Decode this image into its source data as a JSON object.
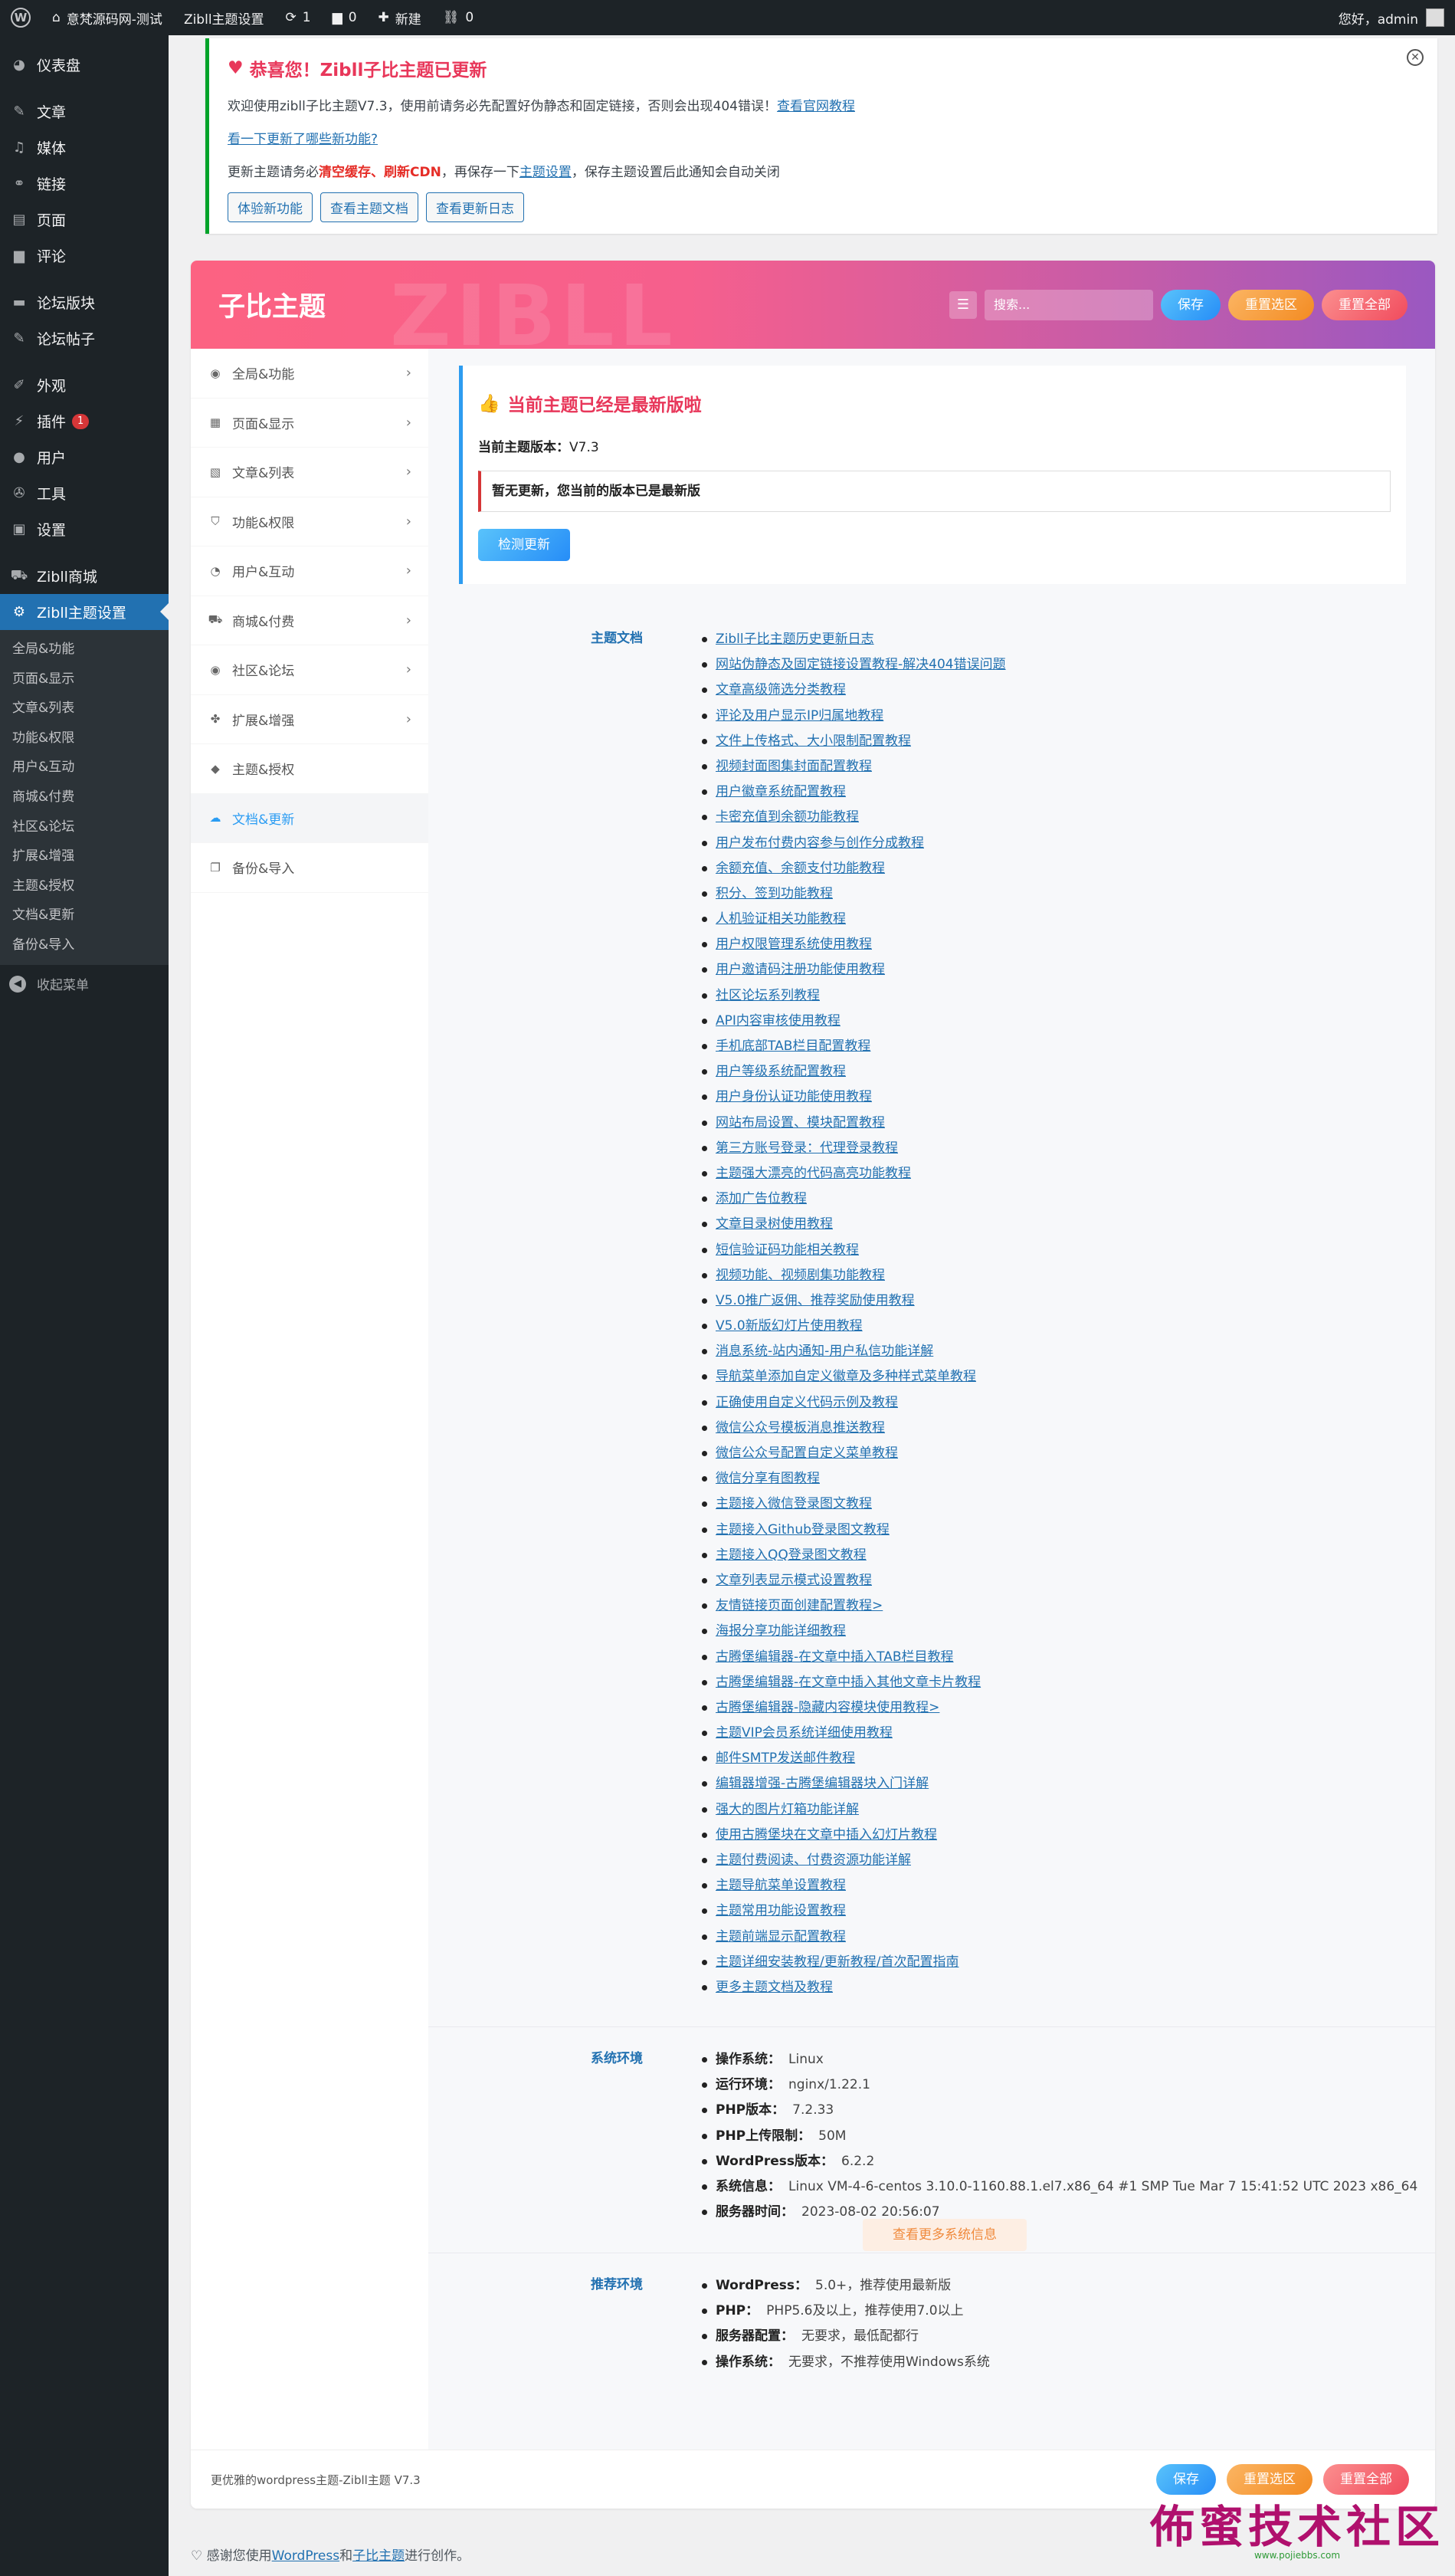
{
  "adminbar": {
    "site_name": "意梵源码网-测试",
    "theme_settings": "Zibll主题设置",
    "updates_count": "1",
    "comments_count": "0",
    "new_label": "新建",
    "links_count": "0",
    "greeting": "您好，admin"
  },
  "sidebar": {
    "menu": [
      {
        "label": "仪表盘",
        "icon": "dashboard-icon"
      },
      {
        "label": "文章",
        "icon": "pin-icon"
      },
      {
        "label": "媒体",
        "icon": "media-icon"
      },
      {
        "label": "链接",
        "icon": "link-icon"
      },
      {
        "label": "页面",
        "icon": "page-icon"
      },
      {
        "label": "评论",
        "icon": "comment-icon"
      },
      {
        "label": "论坛版块",
        "icon": "forum-icon"
      },
      {
        "label": "论坛帖子",
        "icon": "pin-icon"
      },
      {
        "label": "外观",
        "icon": "brush-icon"
      },
      {
        "label": "插件",
        "icon": "plugin-icon",
        "badge": "1"
      },
      {
        "label": "用户",
        "icon": "user-icon"
      },
      {
        "label": "工具",
        "icon": "wrench-icon"
      },
      {
        "label": "设置",
        "icon": "settings-icon"
      },
      {
        "label": "Zibll商城",
        "icon": "cart-icon"
      },
      {
        "label": "Zibll主题设置",
        "icon": "gear-icon"
      }
    ],
    "submenu": [
      "全局&功能",
      "页面&显示",
      "文章&列表",
      "功能&权限",
      "用户&互动",
      "商城&付费",
      "社区&论坛",
      "扩展&增强",
      "主题&授权",
      "文档&更新",
      "备份&导入"
    ],
    "collapse": "收起菜单"
  },
  "notice": {
    "title": "恭喜您！Zibll子比主题已更新",
    "line1_text": "欢迎使用zibll子比主题V7.3，使用前请务必先配置好伪静态和固定链接，否则会出现404错误！",
    "line1_link": "查看官网教程",
    "line2_link": "看一下更新了哪些新功能?",
    "line3_a": "更新主题请务必",
    "line3_red1": "清空缓存",
    "line3_sep": "、",
    "line3_red2": "刷新CDN",
    "line3_b": "，再保存一下",
    "line3_link": "主题设置",
    "line3_c": "，保存主题设置后此通知会自动关闭",
    "buttons": [
      "体验新功能",
      "查看主题文档",
      "查看更新日志"
    ]
  },
  "panel": {
    "title": "子比主题",
    "ghost": "ZIBLL",
    "search_placeholder": "搜索...",
    "save": "保存",
    "reset_section": "重置选区",
    "reset_all": "重置全部",
    "nav": [
      {
        "label": "全局&功能",
        "icon": "globe-icon",
        "chevron": true
      },
      {
        "label": "页面&显示",
        "icon": "calendar-icon",
        "chevron": true
      },
      {
        "label": "文章&列表",
        "icon": "map-icon",
        "chevron": true
      },
      {
        "label": "功能&权限",
        "icon": "shield-icon",
        "chevron": true
      },
      {
        "label": "用户&互动",
        "icon": "user-icon",
        "chevron": true
      },
      {
        "label": "商城&付费",
        "icon": "cart-icon",
        "chevron": true
      },
      {
        "label": "社区&论坛",
        "icon": "globe-icon",
        "chevron": true
      },
      {
        "label": "扩展&增强",
        "icon": "puzzle-icon",
        "chevron": true
      },
      {
        "label": "主题&授权",
        "icon": "gitlab-icon",
        "chevron": false
      },
      {
        "label": "文档&更新",
        "icon": "cloud-icon",
        "chevron": false,
        "active": true
      },
      {
        "label": "备份&导入",
        "icon": "copy-icon",
        "chevron": false
      }
    ],
    "update_card": {
      "title": "当前主题已经是最新版啦",
      "version_label": "当前主题版本：",
      "version": "V7.3",
      "message": "暂无更新，您当前的版本已是最新版",
      "check_button": "检测更新"
    },
    "docs_label": "主题文档",
    "docs": [
      "Zibll子比主题历史更新日志",
      "网站伪静态及固定链接设置教程-解决404错误问题",
      "文章高级筛选分类教程",
      "评论及用户显示IP归属地教程",
      "文件上传格式、大小限制配置教程",
      "视频封面图集封面配置教程",
      "用户徽章系统配置教程",
      "卡密充值到余额功能教程",
      "用户发布付费内容参与创作分成教程",
      "余额充值、余额支付功能教程",
      "积分、签到功能教程",
      "人机验证相关功能教程",
      "用户权限管理系统使用教程",
      "用户邀请码注册功能使用教程",
      "社区论坛系列教程",
      "API内容审核使用教程",
      "手机底部TAB栏目配置教程",
      "用户等级系统配置教程",
      "用户身份认证功能使用教程",
      "网站布局设置、模块配置教程",
      "第三方账号登录：代理登录教程",
      "主题强大漂亮的代码高亮功能教程",
      "添加广告位教程",
      "文章目录树使用教程",
      "短信验证码功能相关教程",
      "视频功能、视频剧集功能教程",
      "V5.0推广返佣、推荐奖励使用教程",
      "V5.0新版幻灯片使用教程",
      "消息系统-站内通知-用户私信功能详解",
      "导航菜单添加自定义徽章及多种样式菜单教程",
      "正确使用自定义代码示例及教程",
      "微信公众号模板消息推送教程",
      "微信公众号配置自定义菜单教程",
      "微信分享有图教程",
      "主题接入微信登录图文教程",
      "主题接入Github登录图文教程",
      "主题接入QQ登录图文教程",
      "文章列表显示模式设置教程",
      "友情链接页面创建配置教程>",
      "海报分享功能详细教程",
      "古腾堡编辑器-在文章中插入TAB栏目教程",
      "古腾堡编辑器-在文章中插入其他文章卡片教程",
      "古腾堡编辑器-隐藏内容模块使用教程>",
      "主题VIP会员系统详细使用教程",
      "邮件SMTP发送邮件教程",
      "编辑器增强-古腾堡编辑器块入门详解",
      "强大的图片灯箱功能详解",
      "使用古腾堡块在文章中插入幻灯片教程",
      "主题付费阅读、付费资源功能详解",
      "主题导航菜单设置教程",
      "主题常用功能设置教程",
      "主题前端显示配置教程",
      "主题详细安装教程/更新教程/首次配置指南",
      "更多主题文档及教程"
    ],
    "env_label": "系统环境",
    "env": [
      {
        "k": "操作系统：",
        "v": "Linux"
      },
      {
        "k": "运行环境：",
        "v": "nginx/1.22.1"
      },
      {
        "k": "PHP版本：",
        "v": "7.2.33"
      },
      {
        "k": "PHP上传限制：",
        "v": "50M"
      },
      {
        "k": "WordPress版本：",
        "v": "6.2.2"
      },
      {
        "k": "系统信息：",
        "v": "Linux VM-4-6-centos 3.10.0-1160.88.1.el7.x86_64 #1 SMP Tue Mar 7 15:41:52 UTC 2023 x86_64"
      },
      {
        "k": "服务器时间：",
        "v": "2023-08-02 20:56:07"
      }
    ],
    "env_button": "查看更多系统信息",
    "rec_label": "推荐环境",
    "rec": [
      {
        "k": "WordPress：",
        "v": "5.0+，推荐使用最新版"
      },
      {
        "k": "PHP：",
        "v": "PHP5.6及以上，推荐使用7.0以上"
      },
      {
        "k": "服务器配置：",
        "v": "无要求，最低配都行"
      },
      {
        "k": "操作系统：",
        "v": "无要求，不推荐使用Windows系统"
      }
    ],
    "footer_text": "更优雅的wordpress主题-Zibll主题 V7.3"
  },
  "wpfooter": {
    "text_a": "感谢您使用",
    "link1": "WordPress",
    "text_b": "和",
    "link2": "子比主题",
    "text_c": "进行创作。"
  },
  "watermark": {
    "line1": "佈蜜技术社区",
    "line2": "www.pojiebbs.com"
  }
}
